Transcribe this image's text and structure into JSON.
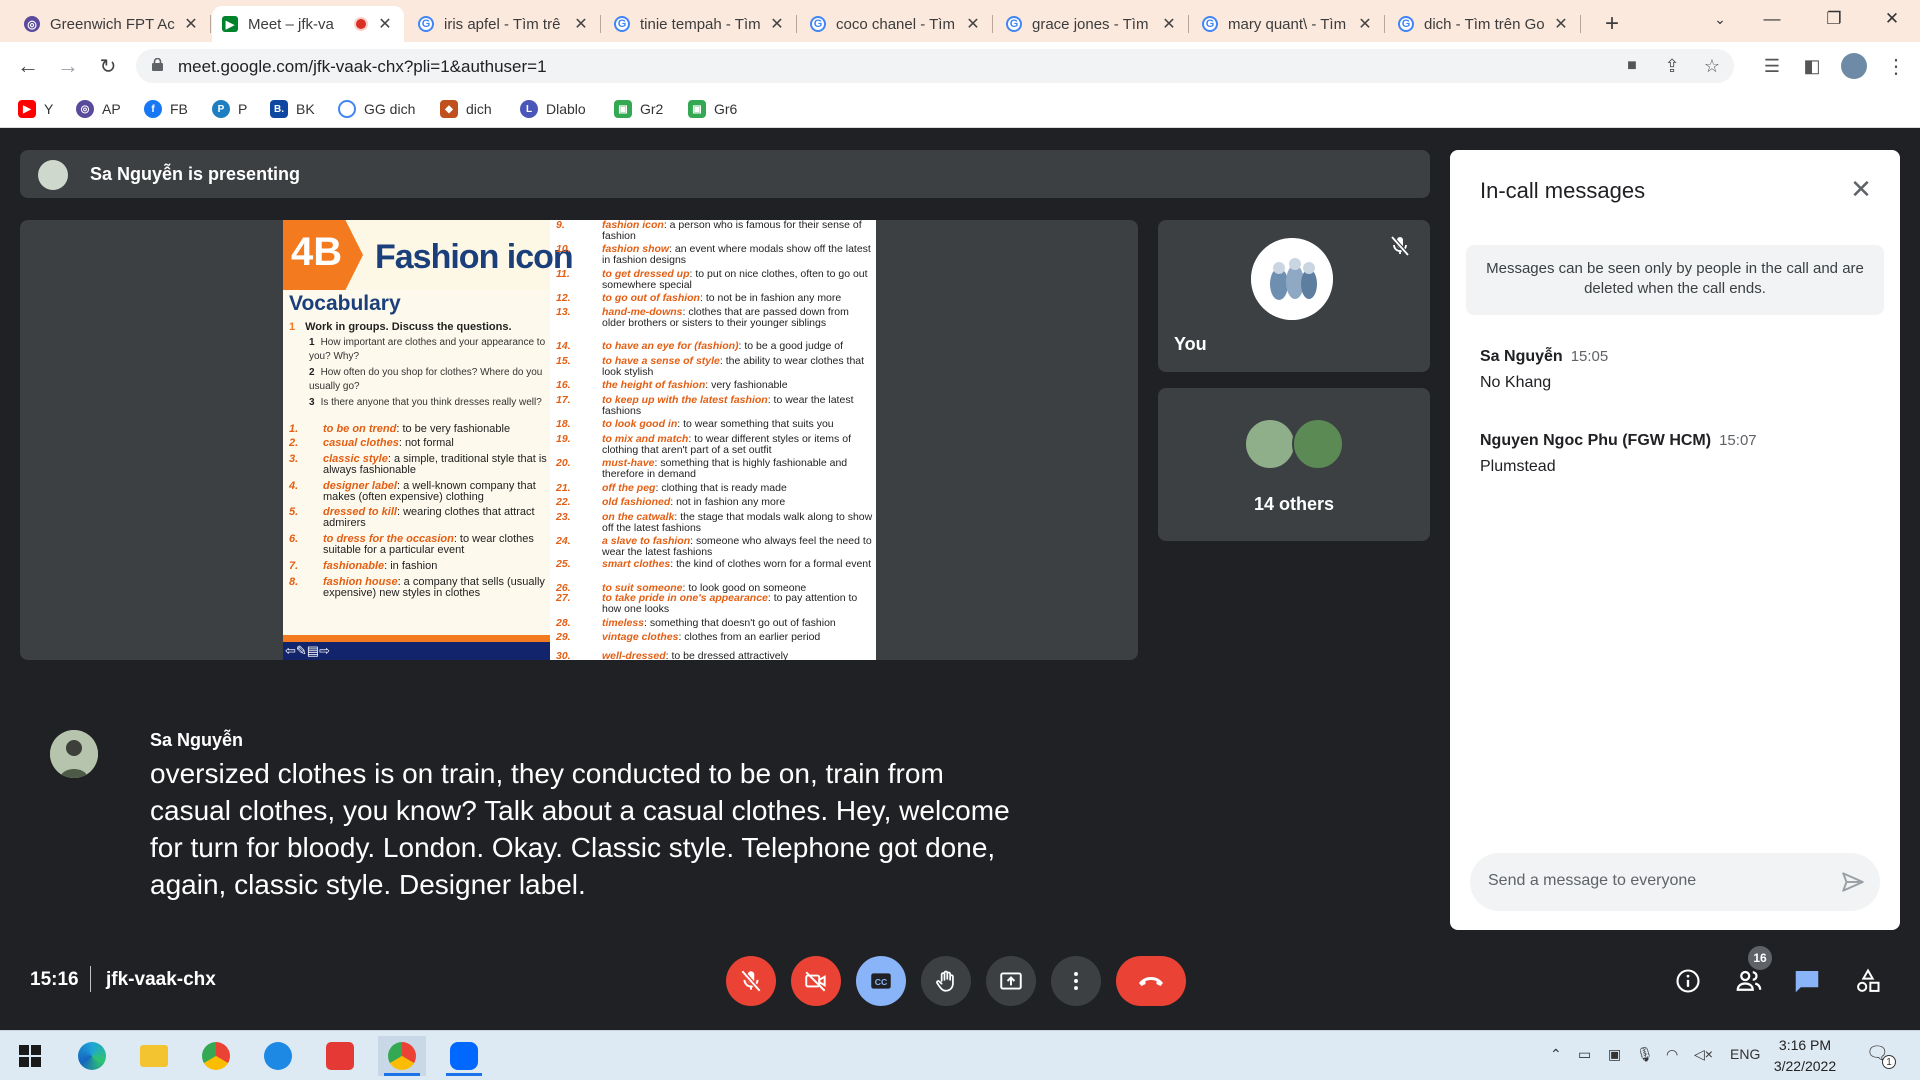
{
  "browser": {
    "tabs": [
      {
        "title": "Greenwich FPT Ac",
        "icon": "globe-icon"
      },
      {
        "title": "Meet – jfk-va",
        "icon": "meet-icon",
        "active": true
      },
      {
        "title": "iris apfel - Tìm trê",
        "icon": "google-icon"
      },
      {
        "title": "tinie tempah - Tìm",
        "icon": "google-icon"
      },
      {
        "title": "coco chanel - Tìm",
        "icon": "google-icon"
      },
      {
        "title": "grace jones - Tìm",
        "icon": "google-icon"
      },
      {
        "title": "mary quant\\ - Tìm",
        "icon": "google-icon"
      },
      {
        "title": "dich - Tìm trên Go",
        "icon": "google-icon"
      }
    ],
    "new_tab": "+",
    "url": "meet.google.com/jfk-vaak-chx?pli=1&authuser=1",
    "bookmarks": [
      {
        "label": "Y",
        "color": "#ff0000"
      },
      {
        "label": "AP",
        "color": "#5a4a9c"
      },
      {
        "label": "FB",
        "color": "#1877f2"
      },
      {
        "label": "P",
        "color": "#1d7fc1"
      },
      {
        "label": "BK",
        "color": "#0d47a1"
      },
      {
        "label": "GG dich",
        "color": "#4285f4"
      },
      {
        "label": "dich",
        "color": "#c0501d"
      },
      {
        "label": "Dlablo",
        "color": "#4a57b8"
      },
      {
        "label": "Gr2",
        "color": "#34a853"
      },
      {
        "label": "Gr6",
        "color": "#34a853"
      }
    ]
  },
  "meet": {
    "presenting_banner": "Sa Nguyễn is presenting",
    "slide": {
      "unit": "4B",
      "title": "Fashion icon",
      "section": "Vocabulary",
      "task_number": "1",
      "task": "Work in groups. Discuss the questions.",
      "questions": [
        {
          "n": "1",
          "text": "How important are clothes and your appearance to you? Why?"
        },
        {
          "n": "2",
          "text": "How often do you shop for clothes? Where do you usually go?"
        },
        {
          "n": "3",
          "text": "Is there anyone that you think dresses really well?"
        }
      ],
      "vocab_left": [
        {
          "n": "1.",
          "term": "to be on trend",
          "def": ": to be very fashionable"
        },
        {
          "n": "2.",
          "term": "casual clothes",
          "def": ": not formal"
        },
        {
          "n": "3.",
          "term": "classic style",
          "def": ": a simple, traditional style that is always fashionable"
        },
        {
          "n": "4.",
          "term": "designer label",
          "def": ": a well-known company that makes (often expensive) clothing"
        },
        {
          "n": "5.",
          "term": "dressed to kill",
          "def": ": wearing clothes that attract admirers"
        },
        {
          "n": "6.",
          "term": "to dress for the occasion",
          "def": ": to wear clothes suitable for a particular event"
        },
        {
          "n": "7.",
          "term": "fashionable",
          "def": ": in fashion"
        },
        {
          "n": "8.",
          "term": "fashion house",
          "def": ": a company that sells (usually expensive) new styles in clothes"
        }
      ],
      "vocab_right": [
        {
          "n": "9.",
          "term": "fashion icon",
          "def": ": a person who is famous for their sense of fashion"
        },
        {
          "n": "10.",
          "term": "fashion show",
          "def": ": an event where modals show off the latest in fashion designs"
        },
        {
          "n": "11.",
          "term": "to get dressed up",
          "def": ": to put on nice clothes, often to go out somewhere special"
        },
        {
          "n": "12.",
          "term": "to go out of fashion",
          "def": ": to not be in fashion any more"
        },
        {
          "n": "13.",
          "term": "hand-me-downs",
          "def": ": clothes that are passed down from older brothers or sisters to their younger siblings"
        },
        {
          "n": "14.",
          "term": "to have an eye for (fashion)",
          "def": ": to be a good judge of"
        },
        {
          "n": "15.",
          "term": "to have a sense of style",
          "def": ": the ability to wear clothes that look stylish"
        },
        {
          "n": "16.",
          "term": "the height of fashion",
          "def": ": very fashionable"
        },
        {
          "n": "17.",
          "term": "to keep up with the latest fashion",
          "def": ": to wear the latest fashions"
        },
        {
          "n": "18.",
          "term": "to look good in",
          "def": ": to wear something that suits you"
        },
        {
          "n": "19.",
          "term": "to mix and match",
          "def": ": to wear different styles or items of clothing that aren't part of a set outfit"
        },
        {
          "n": "20.",
          "term": "must-have",
          "def": ": something that is highly fashionable and therefore in demand"
        },
        {
          "n": "21.",
          "term": "off the peg",
          "def": ": clothing that is ready made"
        },
        {
          "n": "22.",
          "term": "old fashioned",
          "def": ": not in fashion any more"
        },
        {
          "n": "23.",
          "term": "on the catwalk",
          "def": ": the stage that modals walk along to show off the latest fashions"
        },
        {
          "n": "24.",
          "term": "a slave to fashion",
          "def": ": someone who always feel the need to wear the latest fashions"
        },
        {
          "n": "25.",
          "term": "smart clothes",
          "def": ": the kind of clothes worn for a formal event"
        },
        {
          "n": "26.",
          "term": "to suit someone",
          "def": ": to look good on someone"
        },
        {
          "n": "27.",
          "term": "to take pride in one's appearance",
          "def": ": to pay attention to how one looks"
        },
        {
          "n": "28.",
          "term": "timeless",
          "def": ": something that doesn't go out of fashion"
        },
        {
          "n": "29.",
          "term": "vintage clothes",
          "def": ": clothes from an earlier period"
        },
        {
          "n": "30.",
          "term": "well-dressed",
          "def": ": to be dressed attractively"
        }
      ]
    },
    "self_tile_label": "You",
    "others_label": "14 others",
    "caption": {
      "speaker": "Sa Nguyễn",
      "text": "oversized clothes is on train, they conducted to be on, train from casual clothes, you know? Talk about a casual clothes. Hey, welcome for turn for bloody. London. Okay. Classic style. Telephone got done, again, classic style. Designer label."
    },
    "clock": "15:16",
    "meeting_code": "jfk-vaak-chx",
    "participant_count": "16",
    "chat": {
      "title": "In-call messages",
      "notice": "Messages can be seen only by people in the call and are deleted when the call ends.",
      "messages": [
        {
          "sender": "Sa Nguyễn",
          "time": "15:05",
          "text": "No Khang"
        },
        {
          "sender": "Nguyen Ngoc Phu (FGW HCM)",
          "time": "15:07",
          "text": "Plumstead"
        }
      ],
      "input_placeholder": "Send a message to everyone"
    },
    "colors": {
      "danger": "#ea4335",
      "captions_active": "#8ab4f8",
      "background": "#202124",
      "tile": "#3c4043"
    }
  },
  "taskbar": {
    "language": "ENG",
    "time": "3:16 PM",
    "date": "3/22/2022",
    "notification_count": "1"
  }
}
